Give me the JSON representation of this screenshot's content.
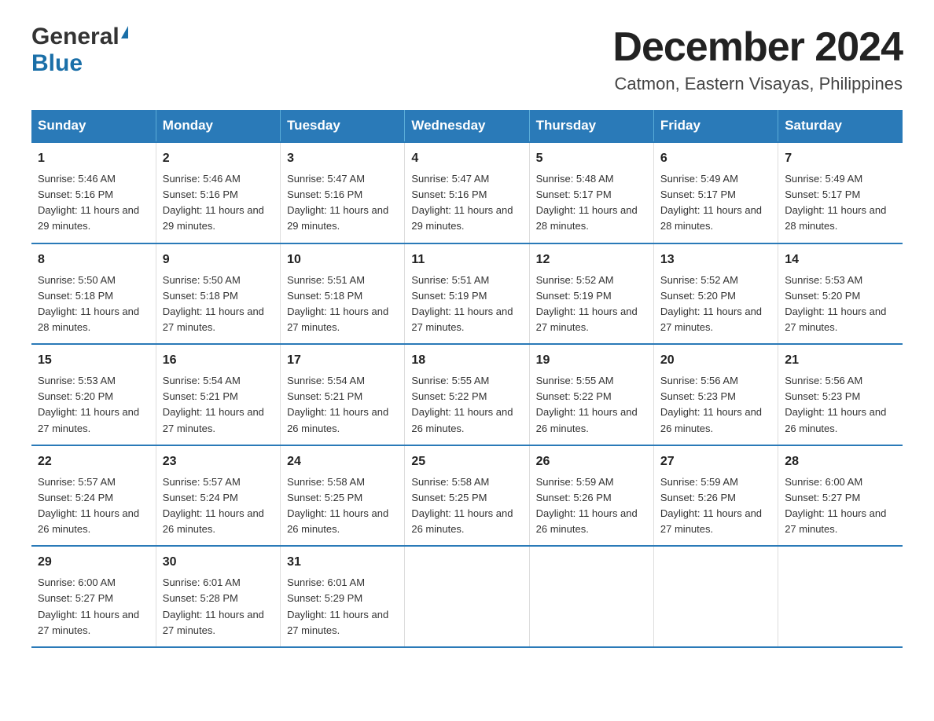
{
  "header": {
    "logo_general": "General",
    "logo_blue": "Blue",
    "month_title": "December 2024",
    "location": "Catmon, Eastern Visayas, Philippines"
  },
  "days_of_week": [
    "Sunday",
    "Monday",
    "Tuesday",
    "Wednesday",
    "Thursday",
    "Friday",
    "Saturday"
  ],
  "weeks": [
    [
      {
        "day": "1",
        "sunrise": "5:46 AM",
        "sunset": "5:16 PM",
        "daylight": "11 hours and 29 minutes."
      },
      {
        "day": "2",
        "sunrise": "5:46 AM",
        "sunset": "5:16 PM",
        "daylight": "11 hours and 29 minutes."
      },
      {
        "day": "3",
        "sunrise": "5:47 AM",
        "sunset": "5:16 PM",
        "daylight": "11 hours and 29 minutes."
      },
      {
        "day": "4",
        "sunrise": "5:47 AM",
        "sunset": "5:16 PM",
        "daylight": "11 hours and 29 minutes."
      },
      {
        "day": "5",
        "sunrise": "5:48 AM",
        "sunset": "5:17 PM",
        "daylight": "11 hours and 28 minutes."
      },
      {
        "day": "6",
        "sunrise": "5:49 AM",
        "sunset": "5:17 PM",
        "daylight": "11 hours and 28 minutes."
      },
      {
        "day": "7",
        "sunrise": "5:49 AM",
        "sunset": "5:17 PM",
        "daylight": "11 hours and 28 minutes."
      }
    ],
    [
      {
        "day": "8",
        "sunrise": "5:50 AM",
        "sunset": "5:18 PM",
        "daylight": "11 hours and 28 minutes."
      },
      {
        "day": "9",
        "sunrise": "5:50 AM",
        "sunset": "5:18 PM",
        "daylight": "11 hours and 27 minutes."
      },
      {
        "day": "10",
        "sunrise": "5:51 AM",
        "sunset": "5:18 PM",
        "daylight": "11 hours and 27 minutes."
      },
      {
        "day": "11",
        "sunrise": "5:51 AM",
        "sunset": "5:19 PM",
        "daylight": "11 hours and 27 minutes."
      },
      {
        "day": "12",
        "sunrise": "5:52 AM",
        "sunset": "5:19 PM",
        "daylight": "11 hours and 27 minutes."
      },
      {
        "day": "13",
        "sunrise": "5:52 AM",
        "sunset": "5:20 PM",
        "daylight": "11 hours and 27 minutes."
      },
      {
        "day": "14",
        "sunrise": "5:53 AM",
        "sunset": "5:20 PM",
        "daylight": "11 hours and 27 minutes."
      }
    ],
    [
      {
        "day": "15",
        "sunrise": "5:53 AM",
        "sunset": "5:20 PM",
        "daylight": "11 hours and 27 minutes."
      },
      {
        "day": "16",
        "sunrise": "5:54 AM",
        "sunset": "5:21 PM",
        "daylight": "11 hours and 27 minutes."
      },
      {
        "day": "17",
        "sunrise": "5:54 AM",
        "sunset": "5:21 PM",
        "daylight": "11 hours and 26 minutes."
      },
      {
        "day": "18",
        "sunrise": "5:55 AM",
        "sunset": "5:22 PM",
        "daylight": "11 hours and 26 minutes."
      },
      {
        "day": "19",
        "sunrise": "5:55 AM",
        "sunset": "5:22 PM",
        "daylight": "11 hours and 26 minutes."
      },
      {
        "day": "20",
        "sunrise": "5:56 AM",
        "sunset": "5:23 PM",
        "daylight": "11 hours and 26 minutes."
      },
      {
        "day": "21",
        "sunrise": "5:56 AM",
        "sunset": "5:23 PM",
        "daylight": "11 hours and 26 minutes."
      }
    ],
    [
      {
        "day": "22",
        "sunrise": "5:57 AM",
        "sunset": "5:24 PM",
        "daylight": "11 hours and 26 minutes."
      },
      {
        "day": "23",
        "sunrise": "5:57 AM",
        "sunset": "5:24 PM",
        "daylight": "11 hours and 26 minutes."
      },
      {
        "day": "24",
        "sunrise": "5:58 AM",
        "sunset": "5:25 PM",
        "daylight": "11 hours and 26 minutes."
      },
      {
        "day": "25",
        "sunrise": "5:58 AM",
        "sunset": "5:25 PM",
        "daylight": "11 hours and 26 minutes."
      },
      {
        "day": "26",
        "sunrise": "5:59 AM",
        "sunset": "5:26 PM",
        "daylight": "11 hours and 26 minutes."
      },
      {
        "day": "27",
        "sunrise": "5:59 AM",
        "sunset": "5:26 PM",
        "daylight": "11 hours and 27 minutes."
      },
      {
        "day": "28",
        "sunrise": "6:00 AM",
        "sunset": "5:27 PM",
        "daylight": "11 hours and 27 minutes."
      }
    ],
    [
      {
        "day": "29",
        "sunrise": "6:00 AM",
        "sunset": "5:27 PM",
        "daylight": "11 hours and 27 minutes."
      },
      {
        "day": "30",
        "sunrise": "6:01 AM",
        "sunset": "5:28 PM",
        "daylight": "11 hours and 27 minutes."
      },
      {
        "day": "31",
        "sunrise": "6:01 AM",
        "sunset": "5:29 PM",
        "daylight": "11 hours and 27 minutes."
      },
      {
        "day": "",
        "sunrise": "",
        "sunset": "",
        "daylight": ""
      },
      {
        "day": "",
        "sunrise": "",
        "sunset": "",
        "daylight": ""
      },
      {
        "day": "",
        "sunrise": "",
        "sunset": "",
        "daylight": ""
      },
      {
        "day": "",
        "sunrise": "",
        "sunset": "",
        "daylight": ""
      }
    ]
  ],
  "labels": {
    "sunrise": "Sunrise:",
    "sunset": "Sunset:",
    "daylight": "Daylight:"
  }
}
